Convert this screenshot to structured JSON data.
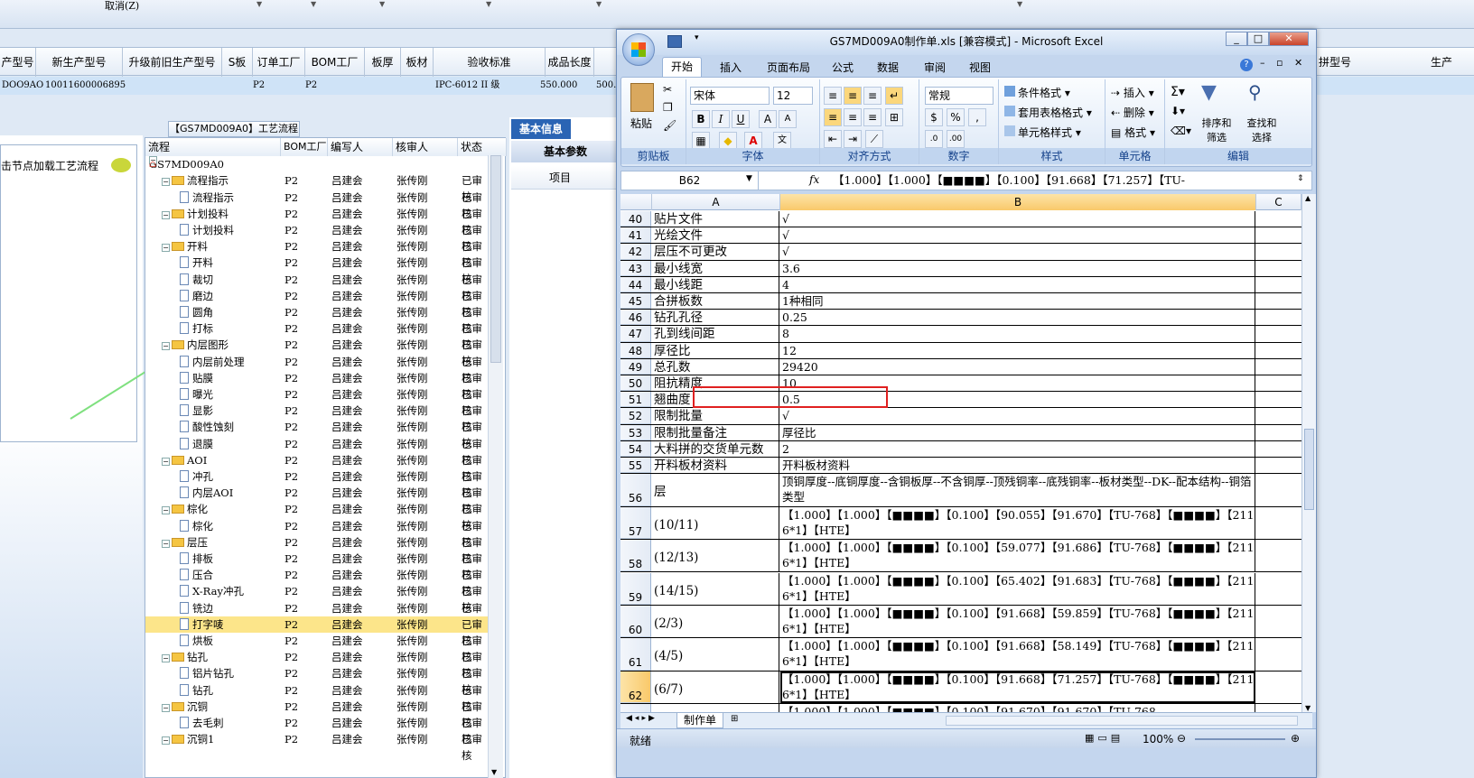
{
  "bg": {
    "menu_cancel": "取消(Z)",
    "headers": [
      "产型号",
      "新生产型号",
      "升级前旧生产型号",
      "S板",
      "订单工厂",
      "BOM工厂",
      "板厚",
      "板材",
      "验收标准",
      "成品长度",
      "成"
    ],
    "row": [
      "DOO9AO",
      "10011600006895",
      "",
      "",
      "P2",
      "P2",
      "",
      "",
      "IPC-6012 II 级",
      "550.000",
      "500."
    ],
    "right_headers": [
      "拼型号",
      "生产"
    ],
    "left_hint": "击节点加载工艺流程",
    "tree_title": "【GS7MD009A0】工艺流程",
    "tree_headers": [
      "流程",
      "BOM工厂",
      "编写人",
      "核审人",
      "状态"
    ],
    "tree_root": "GS7MD009A0",
    "tree_rows": [
      {
        "label": "流程指示",
        "type": "folder",
        "bom": "P2",
        "writer": "吕建会",
        "reviewer": "张传刚",
        "status": "已审核"
      },
      {
        "label": "流程指示",
        "type": "doc",
        "bom": "P2",
        "writer": "吕建会",
        "reviewer": "张传刚",
        "status": "已审核"
      },
      {
        "label": "计划投料",
        "type": "folder",
        "bom": "P2",
        "writer": "吕建会",
        "reviewer": "张传刚",
        "status": "已审核"
      },
      {
        "label": "计划投料",
        "type": "doc",
        "bom": "P2",
        "writer": "吕建会",
        "reviewer": "张传刚",
        "status": "已审核"
      },
      {
        "label": "开料",
        "type": "folder",
        "bom": "P2",
        "writer": "吕建会",
        "reviewer": "张传刚",
        "status": "已审核"
      },
      {
        "label": "开料",
        "type": "doc",
        "bom": "P2",
        "writer": "吕建会",
        "reviewer": "张传刚",
        "status": "已审核"
      },
      {
        "label": "裁切",
        "type": "doc",
        "bom": "P2",
        "writer": "吕建会",
        "reviewer": "张传刚",
        "status": "已审核"
      },
      {
        "label": "磨边",
        "type": "doc",
        "bom": "P2",
        "writer": "吕建会",
        "reviewer": "张传刚",
        "status": "已审核"
      },
      {
        "label": "圆角",
        "type": "doc",
        "bom": "P2",
        "writer": "吕建会",
        "reviewer": "张传刚",
        "status": "已审核"
      },
      {
        "label": "打标",
        "type": "doc",
        "bom": "P2",
        "writer": "吕建会",
        "reviewer": "张传刚",
        "status": "已审核"
      },
      {
        "label": "内层图形",
        "type": "folder",
        "bom": "P2",
        "writer": "吕建会",
        "reviewer": "张传刚",
        "status": "已审核"
      },
      {
        "label": "内层前处理",
        "type": "doc",
        "bom": "P2",
        "writer": "吕建会",
        "reviewer": "张传刚",
        "status": "已审核"
      },
      {
        "label": "贴膜",
        "type": "doc",
        "bom": "P2",
        "writer": "吕建会",
        "reviewer": "张传刚",
        "status": "已审核"
      },
      {
        "label": "曝光",
        "type": "doc",
        "bom": "P2",
        "writer": "吕建会",
        "reviewer": "张传刚",
        "status": "已审核"
      },
      {
        "label": "显影",
        "type": "doc",
        "bom": "P2",
        "writer": "吕建会",
        "reviewer": "张传刚",
        "status": "已审核"
      },
      {
        "label": "酸性蚀刻",
        "type": "doc",
        "bom": "P2",
        "writer": "吕建会",
        "reviewer": "张传刚",
        "status": "已审核"
      },
      {
        "label": "退膜",
        "type": "doc",
        "bom": "P2",
        "writer": "吕建会",
        "reviewer": "张传刚",
        "status": "已审核"
      },
      {
        "label": "AOI",
        "type": "folder",
        "bom": "P2",
        "writer": "吕建会",
        "reviewer": "张传刚",
        "status": "已审核"
      },
      {
        "label": "冲孔",
        "type": "doc",
        "bom": "P2",
        "writer": "吕建会",
        "reviewer": "张传刚",
        "status": "已审核"
      },
      {
        "label": "内层AOI",
        "type": "doc",
        "bom": "P2",
        "writer": "吕建会",
        "reviewer": "张传刚",
        "status": "已审核"
      },
      {
        "label": "棕化",
        "type": "folder",
        "bom": "P2",
        "writer": "吕建会",
        "reviewer": "张传刚",
        "status": "已审核"
      },
      {
        "label": "棕化",
        "type": "doc",
        "bom": "P2",
        "writer": "吕建会",
        "reviewer": "张传刚",
        "status": "已审核"
      },
      {
        "label": "层压",
        "type": "folder",
        "bom": "P2",
        "writer": "吕建会",
        "reviewer": "张传刚",
        "status": "已审核"
      },
      {
        "label": "排板",
        "type": "doc",
        "bom": "P2",
        "writer": "吕建会",
        "reviewer": "张传刚",
        "status": "已审核"
      },
      {
        "label": "压合",
        "type": "doc",
        "bom": "P2",
        "writer": "吕建会",
        "reviewer": "张传刚",
        "status": "已审核"
      },
      {
        "label": "X-Ray冲孔",
        "type": "doc",
        "bom": "P2",
        "writer": "吕建会",
        "reviewer": "张传刚",
        "status": "已审核"
      },
      {
        "label": "铣边",
        "type": "doc",
        "bom": "P2",
        "writer": "吕建会",
        "reviewer": "张传刚",
        "status": "已审核"
      },
      {
        "label": "打字唛",
        "type": "doc",
        "bom": "P2",
        "writer": "吕建会",
        "reviewer": "张传刚",
        "status": "已审核",
        "selected": true
      },
      {
        "label": "烘板",
        "type": "doc",
        "bom": "P2",
        "writer": "吕建会",
        "reviewer": "张传刚",
        "status": "已审核"
      },
      {
        "label": "钻孔",
        "type": "folder",
        "bom": "P2",
        "writer": "吕建会",
        "reviewer": "张传刚",
        "status": "已审核"
      },
      {
        "label": "铝片钻孔",
        "type": "doc",
        "bom": "P2",
        "writer": "吕建会",
        "reviewer": "张传刚",
        "status": "已审核"
      },
      {
        "label": "钻孔",
        "type": "doc",
        "bom": "P2",
        "writer": "吕建会",
        "reviewer": "张传刚",
        "status": "已审核"
      },
      {
        "label": "沉铜",
        "type": "folder",
        "bom": "P2",
        "writer": "吕建会",
        "reviewer": "张传刚",
        "status": "已审核"
      },
      {
        "label": "去毛刺",
        "type": "doc",
        "bom": "P2",
        "writer": "吕建会",
        "reviewer": "张传刚",
        "status": "已审核"
      },
      {
        "label": "沉铜1",
        "type": "folder",
        "bom": "P2",
        "writer": "吕建会",
        "reviewer": "张传刚",
        "status": "已审核"
      }
    ],
    "right_tab": "基本信息",
    "right_subtab": "基本参数",
    "right_col": "项目"
  },
  "xl": {
    "title": "GS7MD009A0制作单.xls [兼容模式] - Microsoft Excel",
    "tabs": [
      "开始",
      "插入",
      "页面布局",
      "公式",
      "数据",
      "审阅",
      "视图"
    ],
    "paste": "粘贴",
    "font_name": "宋体",
    "font_size": "12",
    "number_format": "常规",
    "cond_format": "条件格式",
    "table_format": "套用表格格式",
    "cell_style": "单元格样式",
    "insert": "插入",
    "delete": "删除",
    "format": "格式",
    "sort": "排序和筛选",
    "find": "查找和选择",
    "groups": [
      "剪贴板",
      "字体",
      "对齐方式",
      "数字",
      "样式",
      "单元格",
      "编辑"
    ],
    "namebox": "B62",
    "fx": "fx",
    "formula": "【1.000】【1.000】【■■■■】【0.100】【91.668】【71.257】【TU-",
    "cols": [
      "A",
      "B",
      "C"
    ],
    "rows": [
      {
        "n": "40",
        "a": "贴片文件",
        "b": "√"
      },
      {
        "n": "41",
        "a": "光绘文件",
        "b": "√"
      },
      {
        "n": "42",
        "a": "层压不可更改",
        "b": "√"
      },
      {
        "n": "43",
        "a": "最小线宽",
        "b": "3.6"
      },
      {
        "n": "44",
        "a": "最小线距",
        "b": "4"
      },
      {
        "n": "45",
        "a": "合拼板数",
        "b": "1种相同"
      },
      {
        "n": "46",
        "a": "钻孔孔径",
        "b": "0.25"
      },
      {
        "n": "47",
        "a": "孔到线间距",
        "b": "8"
      },
      {
        "n": "48",
        "a": "厚径比",
        "b": "12"
      },
      {
        "n": "49",
        "a": "总孔数",
        "b": "29420"
      },
      {
        "n": "50",
        "a": "阻抗精度",
        "b": "10"
      },
      {
        "n": "51",
        "a": "翘曲度",
        "b": "0.5"
      },
      {
        "n": "52",
        "a": "限制批量",
        "b": "√"
      },
      {
        "n": "53",
        "a": "限制批量备注",
        "b": "厚径比"
      },
      {
        "n": "54",
        "a": "大料拼的交货单元数",
        "b": "2"
      },
      {
        "n": "55",
        "a": "开料板材资料",
        "b": "开料板材资料"
      },
      {
        "n": "56",
        "a": "层",
        "b": "顶铜厚度--底铜厚度--含铜板厚--不含铜厚--顶残铜率--底残铜率--板材类型--DK--配本结构--铜箔类型"
      },
      {
        "n": "57",
        "a": "(10/11)",
        "b": "【1.000】【1.000】【■■■■】【0.100】【90.055】【91.670】【TU-768】【■■■■】【2116*1】【HTE】"
      },
      {
        "n": "58",
        "a": "(12/13)",
        "b": "【1.000】【1.000】【■■■■】【0.100】【59.077】【91.686】【TU-768】【■■■■】【2116*1】【HTE】"
      },
      {
        "n": "59",
        "a": "(14/15)",
        "b": "【1.000】【1.000】【■■■■】【0.100】【65.402】【91.683】【TU-768】【■■■■】【2116*1】【HTE】"
      },
      {
        "n": "60",
        "a": "(2/3)",
        "b": "【1.000】【1.000】【■■■■】【0.100】【91.668】【59.859】【TU-768】【■■■■】【2116*1】【HTE】"
      },
      {
        "n": "61",
        "a": "(4/5)",
        "b": "【1.000】【1.000】【■■■■】【0.100】【91.668】【58.149】【TU-768】【■■■■】【2116*1】【HTE】"
      },
      {
        "n": "62",
        "a": "(6/7)",
        "b": "【1.000】【1.000】【■■■■】【0.100】【91.668】【71.257】【TU-768】【■■■■】【2116*1】【HTE】"
      }
    ],
    "partial_row": "【1.000】【1.000】【■■■■】【0.100】【91.670】【91.670】【TU-768",
    "sheet_tab": "制作单",
    "status": "就绪",
    "zoom": "100%"
  },
  "colors": {
    "accent": "#2a64b4",
    "highlight_box": "#e02020",
    "selected_row": "#fce58a",
    "arrow": "#7fe07f"
  }
}
